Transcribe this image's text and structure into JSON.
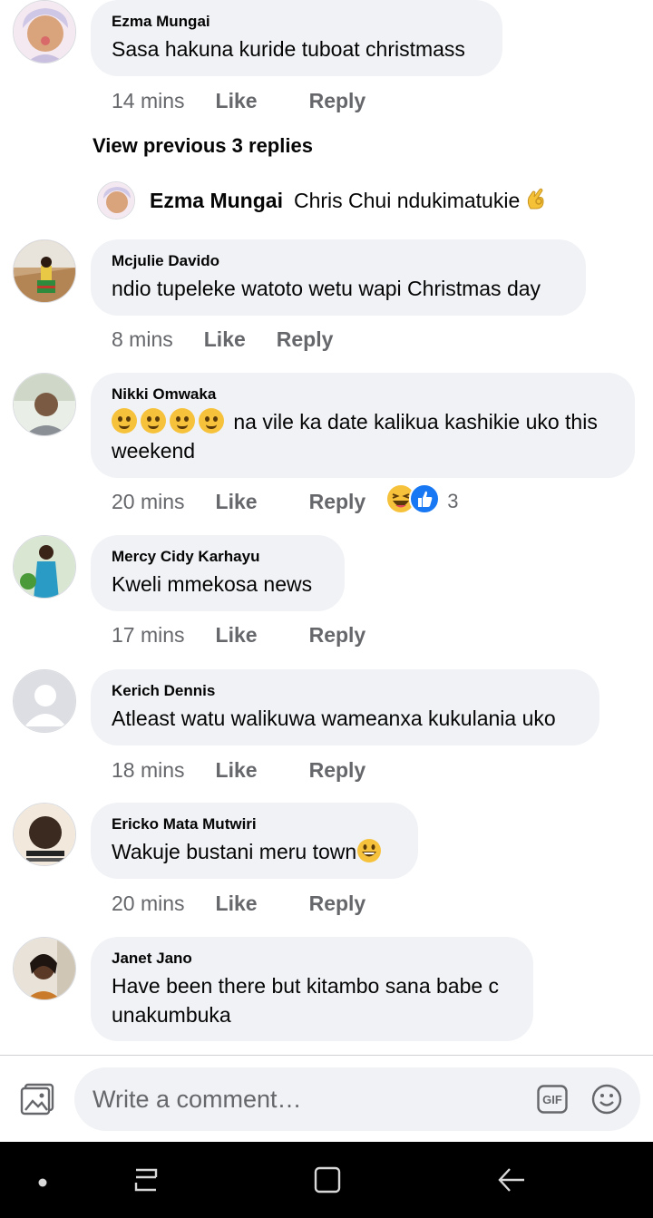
{
  "comments": [
    {
      "author": "Ezma Mungai",
      "text": "Sasa hakuna kuride tuboat christmass",
      "time": "14 mins",
      "like": "Like",
      "reply": "Reply"
    },
    {
      "author": "Mcjulie Davido",
      "text": "ndio tupeleke watoto wetu wapi Christmas day",
      "time": "8 mins",
      "like": "Like",
      "reply": "Reply"
    },
    {
      "author": "Nikki Omwaka",
      "text": "na vile ka date kalikua kashikie uko this weekend",
      "time": "20 mins",
      "like": "Like",
      "reply": "Reply",
      "reaction_count": "3"
    },
    {
      "author": "Mercy Cidy Karhayu",
      "text": "Kweli mmekosa news",
      "time": "17 mins",
      "like": "Like",
      "reply": "Reply"
    },
    {
      "author": "Kerich Dennis",
      "text": "Atleast watu walikuwa wameanxa kukulania uko",
      "time": "18 mins",
      "like": "Like",
      "reply": "Reply"
    },
    {
      "author": "Ericko Mata Mutwiri",
      "text": "Wakuje bustani meru town",
      "time": "20 mins",
      "like": "Like",
      "reply": "Reply"
    },
    {
      "author": "Janet Jano",
      "text": "Have been there but kitambo sana babe c unakumbuka"
    }
  ],
  "replies": {
    "view_previous": "View previous 3 replies",
    "latest": {
      "author": "Ezma Mungai",
      "text": "Chris Chui ndukimatukie"
    }
  },
  "composer": {
    "placeholder": "Write a comment…",
    "gif_label": "GIF"
  },
  "icons": [
    "photo-icon",
    "gif-icon",
    "smiley-icon",
    "recent-apps-icon",
    "home-icon",
    "back-icon"
  ],
  "colors": {
    "bubble": "#f0f2f5",
    "meta": "#65676b",
    "text": "#050505",
    "like_blue": "#1877f2"
  }
}
